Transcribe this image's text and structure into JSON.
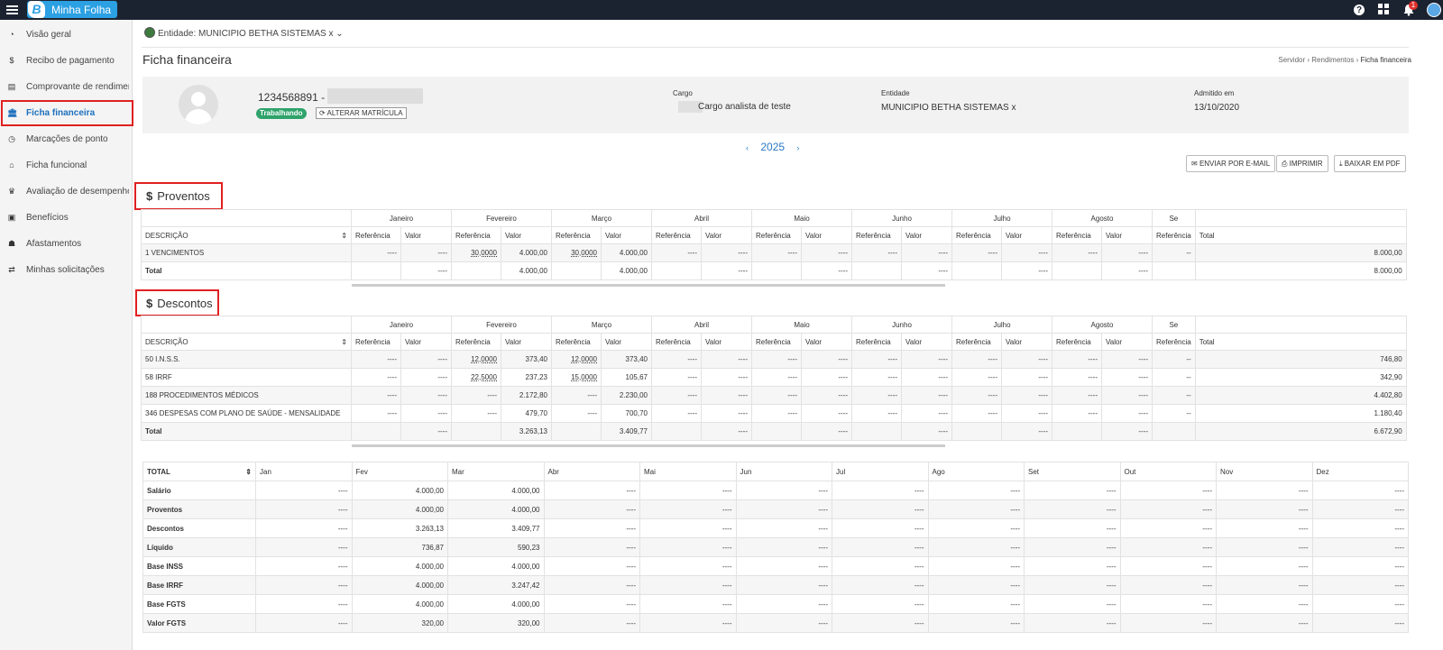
{
  "app": {
    "title": "Minha Folha",
    "logo_letter": "B",
    "notification_count": "1"
  },
  "sidebar": {
    "items": [
      {
        "label": "Visão geral",
        "icon": "pie-chart-icon",
        "glyph": "◔"
      },
      {
        "label": "Recibo de pagamento",
        "icon": "dollar-icon",
        "glyph": "$"
      },
      {
        "label": "Comprovante de rendimentos",
        "icon": "file-icon",
        "glyph": "▤"
      },
      {
        "label": "Ficha financeira",
        "icon": "bank-icon",
        "glyph": "🏛"
      },
      {
        "label": "Marcações de ponto",
        "icon": "clock-icon",
        "glyph": "◷"
      },
      {
        "label": "Ficha funcional",
        "icon": "lock-icon",
        "glyph": "⌂"
      },
      {
        "label": "Avaliação de desempenho",
        "icon": "trophy-icon",
        "glyph": "♛"
      },
      {
        "label": "Benefícios",
        "icon": "gift-icon",
        "glyph": "▣"
      },
      {
        "label": "Afastamentos",
        "icon": "user-minus-icon",
        "glyph": "☗"
      },
      {
        "label": "Minhas solicitações",
        "icon": "exchange-icon",
        "glyph": "⇄"
      }
    ],
    "active_index": 3
  },
  "header": {
    "entity": "Entidade: MUNICIPIO BETHA SISTEMAS x",
    "page_title": "Ficha financeira",
    "breadcrumb": [
      "Servidor",
      "Rendimentos",
      "Ficha financeira"
    ]
  },
  "profile": {
    "id": "1234568891 -",
    "status": "Trabalhando",
    "change_button": "ALTERAR MATRÍCULA",
    "cargo_label": "Cargo",
    "cargo_value": "Cargo analista de teste",
    "entidade_label": "Entidade",
    "entidade_value": "MUNICIPIO BETHA SISTEMAS x",
    "admitido_label": "Admitido em",
    "admitido_value": "13/10/2020"
  },
  "year": "2025",
  "actions": {
    "email": "ENVIAR POR E-MAIL",
    "print": "IMPRIMIR",
    "pdf": "BAIXAR EM PDF"
  },
  "columns": {
    "descricao": "DESCRIÇÃO",
    "total": "Total",
    "months": [
      "Janeiro",
      "Fevereiro",
      "Março",
      "Abril",
      "Maio",
      "Junho",
      "Julho",
      "Agosto",
      "Se"
    ],
    "referencia": "Referência",
    "valor": "Valor"
  },
  "proventos": {
    "title": "Proventos",
    "rows": [
      {
        "desc": "1 VENCIMENTOS",
        "cells": [
          "----",
          "----",
          "30,0000",
          "4.000,00",
          "30,0000",
          "4.000,00",
          "----",
          "----",
          "----",
          "----",
          "----",
          "----",
          "----",
          "----",
          "----",
          "----",
          "--"
        ],
        "total": "8.000,00"
      }
    ],
    "total_row": {
      "desc": "Total",
      "cells": [
        "",
        "----",
        "",
        "4.000,00",
        "",
        "4.000,00",
        "",
        "----",
        "",
        "----",
        "",
        "----",
        "",
        "----",
        "",
        "----",
        ""
      ],
      "total": "8.000,00"
    }
  },
  "descontos": {
    "title": "Descontos",
    "rows": [
      {
        "desc": "50 I.N.S.S.",
        "cells": [
          "----",
          "----",
          "12,0000",
          "373,40",
          "12,0000",
          "373,40",
          "----",
          "----",
          "----",
          "----",
          "----",
          "----",
          "----",
          "----",
          "----",
          "----",
          "--"
        ],
        "total": "746,80"
      },
      {
        "desc": "58 IRRF",
        "cells": [
          "----",
          "----",
          "22,5000",
          "237,23",
          "15,0000",
          "105,67",
          "----",
          "----",
          "----",
          "----",
          "----",
          "----",
          "----",
          "----",
          "----",
          "----",
          "--"
        ],
        "total": "342,90"
      },
      {
        "desc": "188 PROCEDIMENTOS MÉDICOS",
        "cells": [
          "----",
          "----",
          "----",
          "2.172,80",
          "----",
          "2.230,00",
          "----",
          "----",
          "----",
          "----",
          "----",
          "----",
          "----",
          "----",
          "----",
          "----",
          "--"
        ],
        "total": "4.402,80"
      },
      {
        "desc": "346 DESPESAS COM PLANO DE SAÚDE - MENSALIDADE",
        "cells": [
          "----",
          "----",
          "----",
          "479,70",
          "----",
          "700,70",
          "----",
          "----",
          "----",
          "----",
          "----",
          "----",
          "----",
          "----",
          "----",
          "----",
          "--"
        ],
        "total": "1.180,40"
      }
    ],
    "total_row": {
      "desc": "Total",
      "cells": [
        "",
        "----",
        "",
        "3.263,13",
        "",
        "3.409,77",
        "",
        "----",
        "",
        "----",
        "",
        "----",
        "",
        "----",
        "",
        "----",
        ""
      ],
      "total": "6.672,90"
    }
  },
  "totals": {
    "header": [
      "TOTAL",
      "Jan",
      "Fev",
      "Mar",
      "Abr",
      "Mai",
      "Jun",
      "Jul",
      "Ago",
      "Set",
      "Out",
      "Nov",
      "Dez"
    ],
    "rows": [
      {
        "label": "Salário",
        "values": [
          "----",
          "4.000,00",
          "4.000,00",
          "----",
          "----",
          "----",
          "----",
          "----",
          "----",
          "----",
          "----",
          "----"
        ]
      },
      {
        "label": "Proventos",
        "values": [
          "----",
          "4.000,00",
          "4.000,00",
          "----",
          "----",
          "----",
          "----",
          "----",
          "----",
          "----",
          "----",
          "----"
        ]
      },
      {
        "label": "Descontos",
        "values": [
          "----",
          "3.263,13",
          "3.409,77",
          "----",
          "----",
          "----",
          "----",
          "----",
          "----",
          "----",
          "----",
          "----"
        ]
      },
      {
        "label": "Líquido",
        "values": [
          "----",
          "736,87",
          "590,23",
          "----",
          "----",
          "----",
          "----",
          "----",
          "----",
          "----",
          "----",
          "----"
        ]
      },
      {
        "label": "Base INSS",
        "values": [
          "----",
          "4.000,00",
          "4.000,00",
          "----",
          "----",
          "----",
          "----",
          "----",
          "----",
          "----",
          "----",
          "----"
        ]
      },
      {
        "label": "Base IRRF",
        "values": [
          "----",
          "4.000,00",
          "3.247,42",
          "----",
          "----",
          "----",
          "----",
          "----",
          "----",
          "----",
          "----",
          "----"
        ]
      },
      {
        "label": "Base FGTS",
        "values": [
          "----",
          "4.000,00",
          "4.000,00",
          "----",
          "----",
          "----",
          "----",
          "----",
          "----",
          "----",
          "----",
          "----"
        ]
      },
      {
        "label": "Valor FGTS",
        "values": [
          "----",
          "320,00",
          "320,00",
          "----",
          "----",
          "----",
          "----",
          "----",
          "----",
          "----",
          "----",
          "----"
        ]
      }
    ]
  }
}
